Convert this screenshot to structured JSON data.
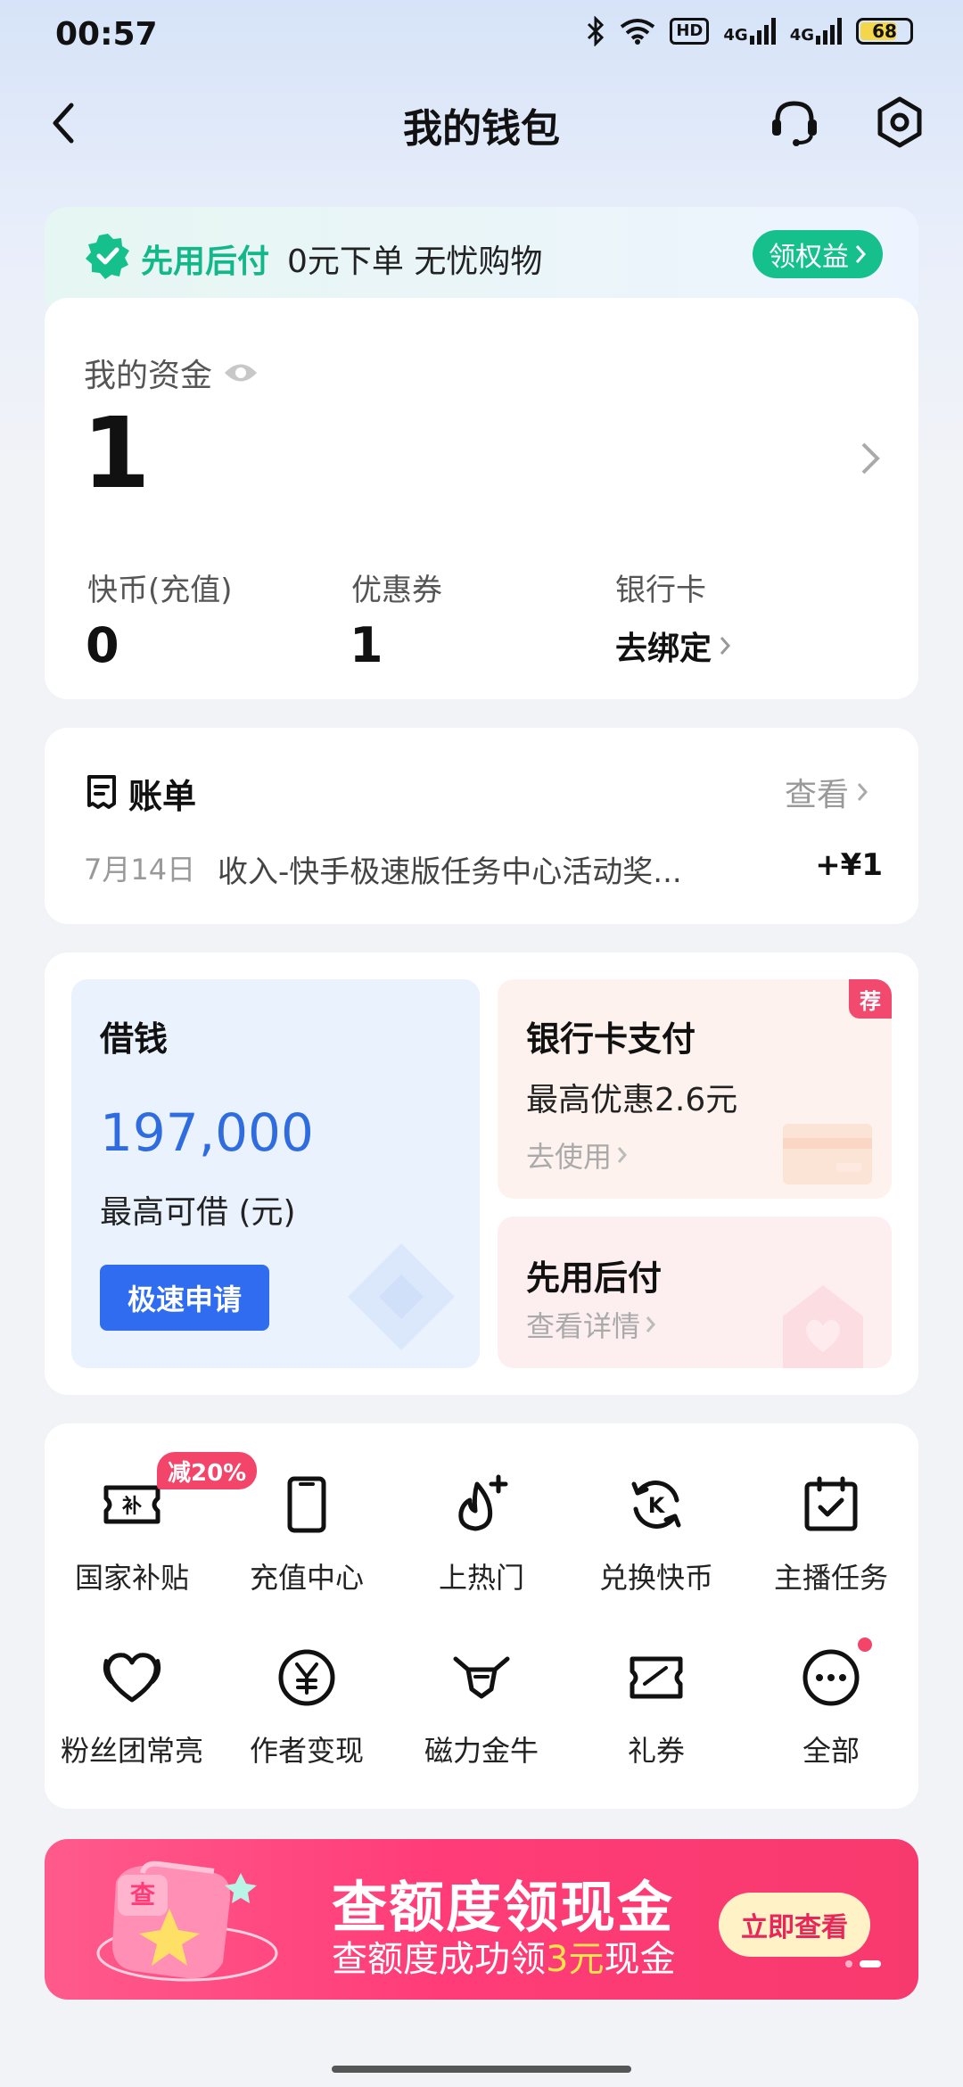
{
  "status_bar": {
    "time": "00:57",
    "hd": "HD",
    "net1": "4G",
    "net2": "4G",
    "battery": "68"
  },
  "nav": {
    "title": "我的钱包"
  },
  "promo": {
    "title": "先用后付",
    "desc": "0元下单 无忧购物",
    "button": "领权益"
  },
  "funds": {
    "label": "我的资金",
    "value": "1",
    "stats": [
      {
        "label": "快币(充值)",
        "value": "0"
      },
      {
        "label": "优惠券",
        "value": "1"
      },
      {
        "label": "银行卡",
        "link": "去绑定"
      }
    ]
  },
  "bill": {
    "title": "账单",
    "view": "查看",
    "date": "7月14日",
    "desc": "收入-快手极速版任务中心活动奖...",
    "amount": "+¥1"
  },
  "finance": {
    "loan": {
      "title": "借钱",
      "amount": "197,000",
      "sub": "最高可借 (元)",
      "button": "极速申请"
    },
    "bank": {
      "title": "银行卡支付",
      "sub": "最高优惠2.6元",
      "link": "去使用",
      "badge": "荐"
    },
    "bnpl": {
      "title": "先用后付",
      "link": "查看详情"
    }
  },
  "grid": {
    "badge": "减20%",
    "items": [
      {
        "label": "国家补贴",
        "icon": "subsidy-icon"
      },
      {
        "label": "充值中心",
        "icon": "phone-icon"
      },
      {
        "label": "上热门",
        "icon": "flame-plus-icon"
      },
      {
        "label": "兑换快币",
        "icon": "exchange-k-icon"
      },
      {
        "label": "主播任务",
        "icon": "calendar-check-icon"
      },
      {
        "label": "粉丝团常亮",
        "icon": "heart-icon"
      },
      {
        "label": "作者变现",
        "icon": "yen-circle-icon"
      },
      {
        "label": "磁力金牛",
        "icon": "bull-icon"
      },
      {
        "label": "礼券",
        "icon": "ticket-icon"
      },
      {
        "label": "全部",
        "icon": "more-icon"
      }
    ]
  },
  "banner": {
    "art_text": "查",
    "title": "查额度领现金",
    "sub_before": "查额度成功领",
    "sub_highlight": "3元",
    "sub_after": "现金",
    "button": "立即查看"
  },
  "colors": {
    "accent_green": "#16c08c",
    "loan_blue": "#2f6ce0",
    "badge_red": "#f3456a"
  }
}
